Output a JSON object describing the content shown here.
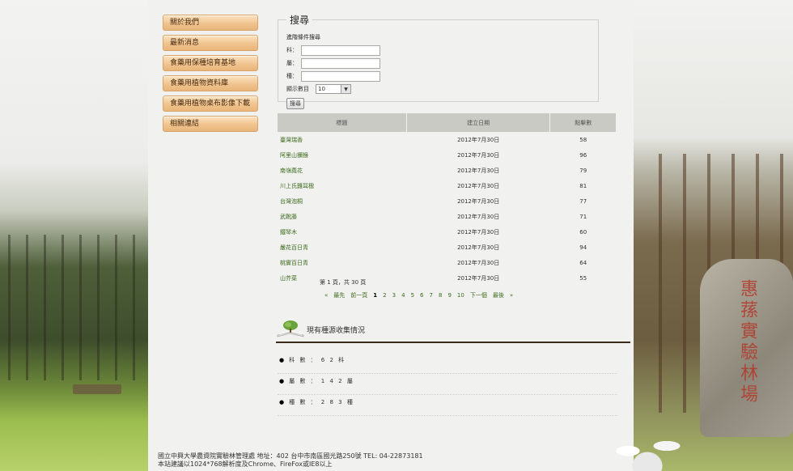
{
  "sidebar": {
    "items": [
      {
        "label": "關於我們"
      },
      {
        "label": "最新消息"
      },
      {
        "label": "食藥用保種培育基地"
      },
      {
        "label": "食藥用植物資料庫"
      },
      {
        "label": "食藥用植物桌布影像下載"
      },
      {
        "label": "相關連結"
      }
    ]
  },
  "search": {
    "legend": "搜尋",
    "advanced_title": "進階條件搜尋",
    "family_label": "科：",
    "genus_label": "屬：",
    "species_label": "種：",
    "count_label": "顯示數目",
    "count_value": "10",
    "button_label": "搜尋"
  },
  "table": {
    "headers": {
      "title": "標題",
      "date": "建立日期",
      "hits": "點擊數"
    },
    "rows": [
      {
        "title": "臺灣瑞香",
        "date": "2012年7月30日",
        "hits": "58"
      },
      {
        "title": "阿里山獼猴",
        "date": "2012年7月30日",
        "hits": "96"
      },
      {
        "title": "南嶺蕘花",
        "date": "2012年7月30日",
        "hits": "79"
      },
      {
        "title": "川上氏雞耳楹",
        "date": "2012年7月30日",
        "hits": "81"
      },
      {
        "title": "台灣泡桐",
        "date": "2012年7月30日",
        "hits": "77"
      },
      {
        "title": "武靴藤",
        "date": "2012年7月30日",
        "hits": "71"
      },
      {
        "title": "鐵琴木",
        "date": "2012年7月30日",
        "hits": "60"
      },
      {
        "title": "嚴花百日青",
        "date": "2012年7月30日",
        "hits": "94"
      },
      {
        "title": "桃實百日青",
        "date": "2012年7月30日",
        "hits": "64"
      },
      {
        "title": "山芥菜",
        "date": "2012年7月30日",
        "hits": "55"
      }
    ]
  },
  "pager": {
    "info": "第 1 頁，共 30 頁",
    "first": "«",
    "first_label": "最先",
    "prev": "前一頁",
    "pages": [
      "1",
      "2",
      "3",
      "4",
      "5",
      "6",
      "7",
      "8",
      "9",
      "10"
    ],
    "next": "下一個",
    "last_label": "最後",
    "last": "»"
  },
  "collection": {
    "title": "現有種源收集情況",
    "items": [
      {
        "text": "科 數 ： 6 2 科"
      },
      {
        "text": "屬 數 ： 1 4 2 屬"
      },
      {
        "text": "種 數 ： 2 8 3 種"
      }
    ]
  },
  "scenery": {
    "rock_text": "惠蓀實驗林場"
  },
  "footer": {
    "line1": "國立中興大學農資院實驗林管理處 地址：402 台中市南區國光路250號 TEL: 04-22873181",
    "line2": "本站建議以1024*768解析度及Chrome、FireFox或IE8以上"
  }
}
